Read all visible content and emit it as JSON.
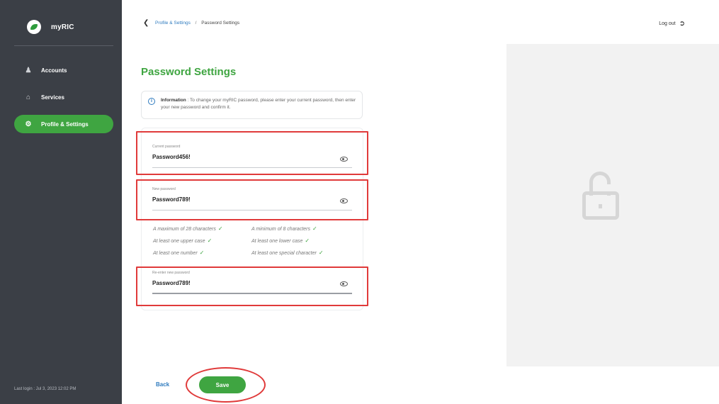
{
  "sidebar": {
    "brand": "myRIC",
    "items": [
      {
        "label": "Accounts",
        "icon": "accounts-icon",
        "active": false
      },
      {
        "label": "Services",
        "icon": "services-icon",
        "active": false
      },
      {
        "label": "Profile & Settings",
        "icon": "gear-icon",
        "active": true
      }
    ],
    "last_login": "Last login : Jul 3, 2023 12:02 PM"
  },
  "header": {
    "breadcrumb_parent": "Profile & Settings",
    "breadcrumb_separator": "/",
    "breadcrumb_current": "Password Settings",
    "logout_label": "Log out"
  },
  "main": {
    "title": "Password Settings",
    "info": {
      "label": "Information",
      "text": ": To change your myRIC password, please enter your current password, then enter your new password and confirm it."
    },
    "fields": {
      "current": {
        "label": "Current password",
        "value": "Password456!"
      },
      "new": {
        "label": "New password",
        "value": "Password789!"
      },
      "confirm": {
        "label": "Re-enter new password",
        "value": "Password789!"
      }
    },
    "rules": [
      {
        "text": "A maximum of 28 characters",
        "met": true
      },
      {
        "text": "A minimum of 8 characters",
        "met": true
      },
      {
        "text": "At least one upper case",
        "met": true
      },
      {
        "text": "At least one lower case",
        "met": true
      },
      {
        "text": "At least one number",
        "met": true
      },
      {
        "text": "At least one special character",
        "met": true
      }
    ],
    "back_label": "Back",
    "save_label": "Save"
  },
  "colors": {
    "brand_green": "#3fa541",
    "sidebar_bg": "#3b3f46",
    "link_blue": "#2f7bbf",
    "highlight_red": "#e03a3a"
  }
}
